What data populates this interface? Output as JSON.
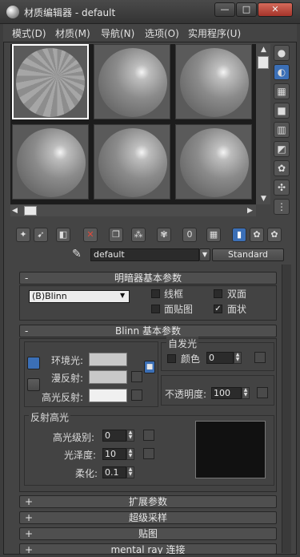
{
  "window": {
    "title": "材质编辑器 - default",
    "min": "—",
    "max": "□",
    "close": "✕"
  },
  "menu": [
    "模式(D)",
    "材质(M)",
    "导航(N)",
    "选项(O)",
    "实用程序(U)"
  ],
  "material": {
    "name": "default",
    "type_button": "Standard"
  },
  "shader_basic": {
    "title": "明暗器基本参数",
    "shader": "(B)Blinn",
    "options": [
      {
        "label": "线框",
        "checked": false
      },
      {
        "label": "双面",
        "checked": false
      },
      {
        "label": "面贴图",
        "checked": false
      },
      {
        "label": "面状",
        "checked": true,
        "mark": "✓"
      }
    ]
  },
  "blinn": {
    "title": "Blinn 基本参数",
    "ambient_label": "环境光:",
    "diffuse_label": "漫反射:",
    "specular_label": "高光反射:",
    "colors": {
      "ambient": "#c8c8c8",
      "diffuse": "#c8c8c8",
      "specular": "#f0f0f0"
    },
    "self_illum": {
      "title": "自发光",
      "color_label": "颜色",
      "value": "0",
      "checked": false
    },
    "opacity": {
      "label": "不透明度:",
      "value": "100"
    },
    "spec_group": {
      "title": "反射高光",
      "level_label": "高光级别:",
      "level_value": "0",
      "gloss_label": "光泽度:",
      "gloss_value": "10",
      "soften_label": "柔化:",
      "soften_value": "0.1"
    }
  },
  "rollouts": [
    {
      "label": "扩展参数",
      "sign": "+"
    },
    {
      "label": "超级采样",
      "sign": "+"
    },
    {
      "label": "贴图",
      "sign": "+"
    },
    {
      "label": "mental ray 连接",
      "sign": "+"
    }
  ],
  "sign_minus": "-",
  "icons": {
    "toolbar": [
      "get-material-icon",
      "put-to-scene-icon",
      "assign-to-selection-icon",
      "reset-map-icon",
      "make-copy-icon",
      "make-unique-icon",
      "put-to-library-icon",
      "material-id-icon",
      "show-map-icon",
      "show-end-result-icon",
      "go-to-parent-icon",
      "go-forward-icon"
    ],
    "side": [
      "sample-type-icon",
      "backlight-icon",
      "background-icon",
      "uv-tiling-icon",
      "video-color-check-icon",
      "make-preview-icon",
      "options-icon",
      "select-by-material-icon",
      "material-navigator-icon"
    ]
  }
}
